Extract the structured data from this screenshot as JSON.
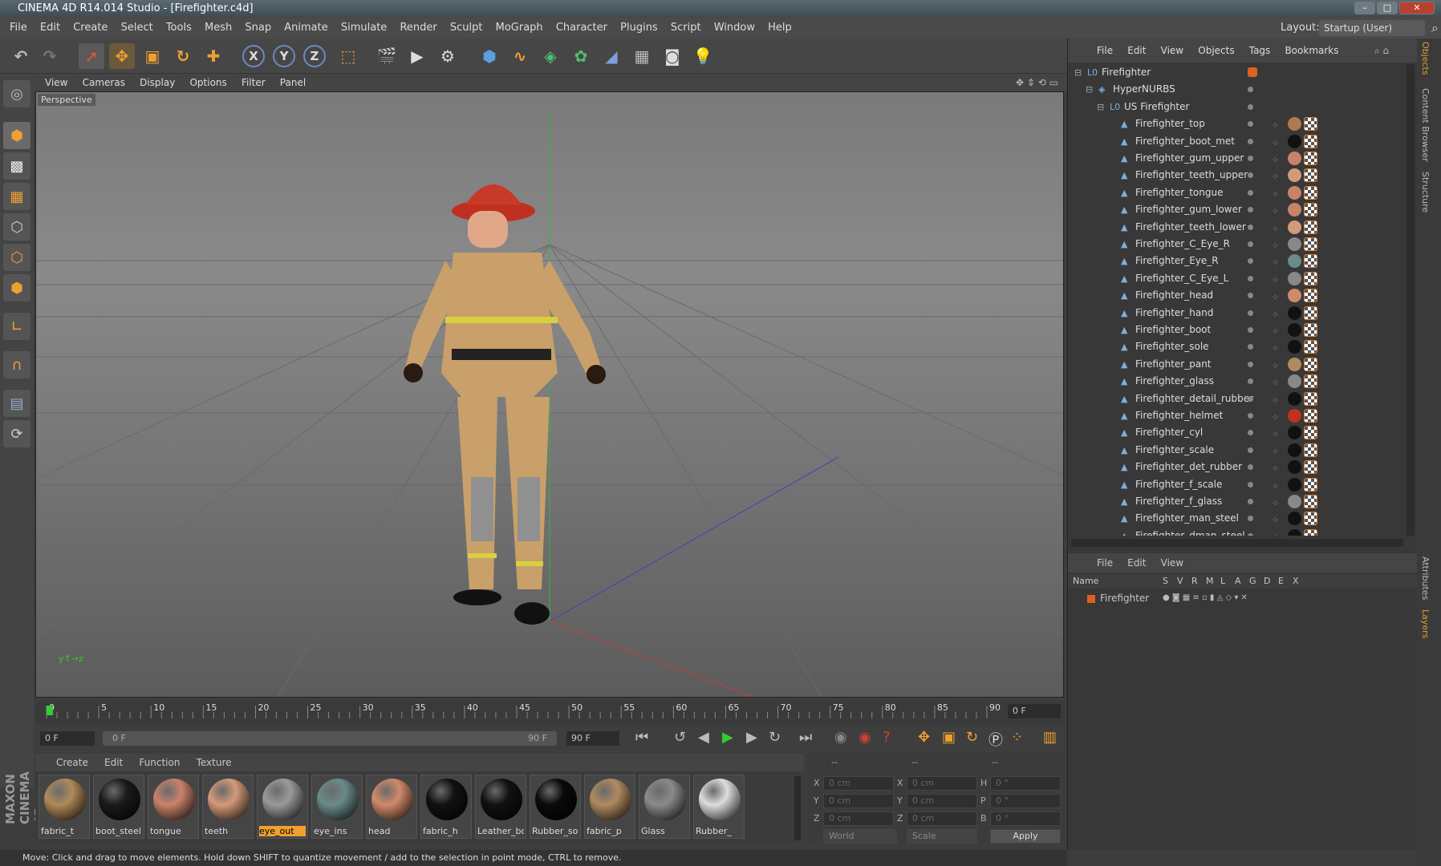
{
  "window": {
    "title": "CINEMA 4D R14.014 Studio - [Firefighter.c4d]",
    "layout_label": "Layout:",
    "layout_value": "Startup (User)"
  },
  "menu": [
    "File",
    "Edit",
    "Create",
    "Select",
    "Tools",
    "Mesh",
    "Snap",
    "Animate",
    "Simulate",
    "Render",
    "Sculpt",
    "MoGraph",
    "Character",
    "Plugins",
    "Script",
    "Window",
    "Help"
  ],
  "viewport": {
    "menu": [
      "View",
      "Cameras",
      "Display",
      "Options",
      "Filter",
      "Panel"
    ],
    "label": "Perspective"
  },
  "timeline": {
    "ticks": [
      "0",
      "5",
      "10",
      "15",
      "20",
      "25",
      "30",
      "35",
      "40",
      "45",
      "50",
      "55",
      "60",
      "65",
      "70",
      "75",
      "80",
      "85",
      "90"
    ],
    "current_frame": "0 F",
    "start": "0 F",
    "range_start": "0 F",
    "range_end": "90 F",
    "end": "90 F"
  },
  "materials": {
    "menu": [
      "Create",
      "Edit",
      "Function",
      "Texture"
    ],
    "items": [
      {
        "label": "fabric_t",
        "color": "#b08a58"
      },
      {
        "label": "boot_steel",
        "color": "#1a1a1a"
      },
      {
        "label": "tongue",
        "color": "#c9826a"
      },
      {
        "label": "teeth",
        "color": "#d39a7a"
      },
      {
        "label": "eye_out",
        "color": "#9a9a9a",
        "selected": true
      },
      {
        "label": "eye_ins",
        "color": "#6b8a8a"
      },
      {
        "label": "head",
        "color": "#d08a6a"
      },
      {
        "label": "fabric_h",
        "color": "#111"
      },
      {
        "label": "Leather_bo",
        "color": "#111"
      },
      {
        "label": "Rubber_so",
        "color": "#0a0a0a"
      },
      {
        "label": "fabric_p",
        "color": "#b08a60"
      },
      {
        "label": "Glass",
        "color": "#8a8a8a"
      },
      {
        "label": "Rubber_",
        "color": "#ddd"
      }
    ]
  },
  "coords": {
    "header": [
      "--",
      "--",
      "--"
    ],
    "rows": [
      {
        "a": "X",
        "av": "0 cm",
        "b": "X",
        "bv": "0 cm",
        "c": "H",
        "cv": "0 °"
      },
      {
        "a": "Y",
        "av": "0 cm",
        "b": "Y",
        "bv": "0 cm",
        "c": "P",
        "cv": "0 °"
      },
      {
        "a": "Z",
        "av": "0 cm",
        "b": "Z",
        "bv": "0 cm",
        "c": "B",
        "cv": "0 °"
      }
    ],
    "world": "World",
    "scale": "Scale",
    "apply": "Apply"
  },
  "status": "Move: Click and drag to move elements. Hold down SHIFT to quantize movement / add to the selection in point mode, CTRL to remove.",
  "objects": {
    "menu": [
      "File",
      "Edit",
      "View",
      "Objects",
      "Tags",
      "Bookmarks"
    ],
    "rows": [
      {
        "name": "Firefighter",
        "level": 0
      },
      {
        "name": "HyperNURBS",
        "level": 1
      },
      {
        "name": "US Firefighter",
        "level": 2
      },
      {
        "name": "Firefighter_top",
        "level": 3,
        "mat": "#b07a50"
      },
      {
        "name": "Firefighter_boot_met",
        "level": 3,
        "mat": "#111"
      },
      {
        "name": "Firefighter_gum_upper",
        "level": 3,
        "mat": "#c9826a"
      },
      {
        "name": "Firefighter_teeth_upper",
        "level": 3,
        "mat": "#d39a7a"
      },
      {
        "name": "Firefighter_tongue",
        "level": 3,
        "mat": "#c9826a"
      },
      {
        "name": "Firefighter_gum_lower",
        "level": 3,
        "mat": "#c9826a"
      },
      {
        "name": "Firefighter_teeth_lower",
        "level": 3,
        "mat": "#d39a7a"
      },
      {
        "name": "Firefighter_C_Eye_R",
        "level": 3,
        "mat": "#888"
      },
      {
        "name": "Firefighter_Eye_R",
        "level": 3,
        "mat": "#6b8a8a"
      },
      {
        "name": "Firefighter_C_Eye_L",
        "level": 3,
        "mat": "#888"
      },
      {
        "name": "Firefighter_head",
        "level": 3,
        "mat": "#d08a6a"
      },
      {
        "name": "Firefighter_hand",
        "level": 3,
        "mat": "#111"
      },
      {
        "name": "Firefighter_boot",
        "level": 3,
        "mat": "#111"
      },
      {
        "name": "Firefighter_sole",
        "level": 3,
        "mat": "#111"
      },
      {
        "name": "Firefighter_pant",
        "level": 3,
        "mat": "#b08a60"
      },
      {
        "name": "Firefighter_glass",
        "level": 3,
        "mat": "#888"
      },
      {
        "name": "Firefighter_detail_rubber",
        "level": 3,
        "mat": "#111"
      },
      {
        "name": "Firefighter_helmet",
        "level": 3,
        "mat": "#c03020"
      },
      {
        "name": "Firefighter_cyl",
        "level": 3,
        "mat": "#111"
      },
      {
        "name": "Firefighter_scale",
        "level": 3,
        "mat": "#111"
      },
      {
        "name": "Firefighter_det_rubber",
        "level": 3,
        "mat": "#111"
      },
      {
        "name": "Firefighter_f_scale",
        "level": 3,
        "mat": "#111"
      },
      {
        "name": "Firefighter_f_glass",
        "level": 3,
        "mat": "#888"
      },
      {
        "name": "Firefighter_man_steel",
        "level": 3,
        "mat": "#111"
      },
      {
        "name": "Firefighter_dman_steel",
        "level": 3,
        "mat": "#111"
      }
    ]
  },
  "layers": {
    "menu": [
      "File",
      "Edit",
      "View"
    ],
    "columns": [
      "Name",
      "S",
      "V",
      "R",
      "M",
      "L",
      "A",
      "G",
      "D",
      "E",
      "X"
    ],
    "row": "Firefighter"
  },
  "side_tabs": [
    "Objects",
    "Content Browser",
    "Structure",
    "Attributes",
    "Layers"
  ],
  "brand": "MAXON CINEMA 4D"
}
